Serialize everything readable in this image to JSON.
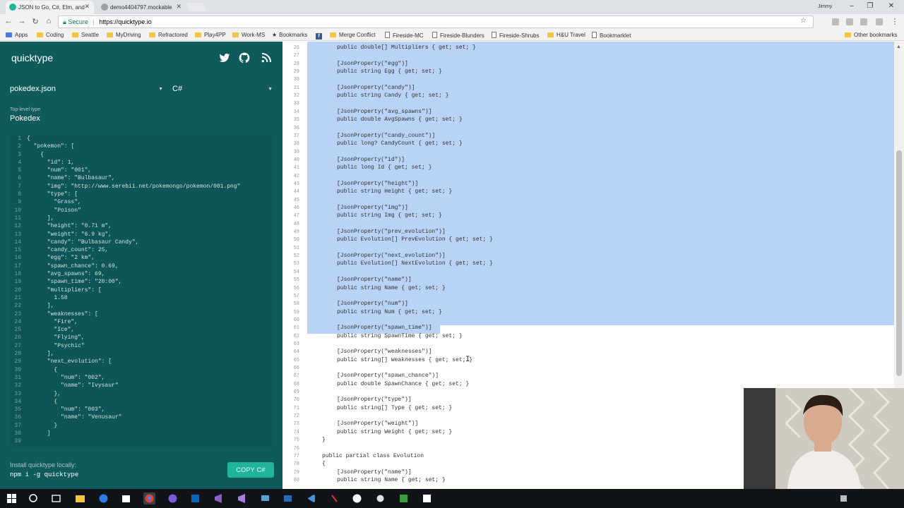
{
  "browser": {
    "tabs": [
      {
        "title": "JSON to Go, C#, Elm, and",
        "active": true,
        "favicon_color": "#1fb59c"
      },
      {
        "title": "demo4404797.mockable",
        "active": false,
        "favicon_color": "#9aa0a6"
      }
    ],
    "profile_name": "Jimmy",
    "window_controls": [
      "minimize-icon",
      "restore-icon",
      "close-icon"
    ],
    "secure_label": "Secure",
    "url": "https://quicktype.io",
    "bookmarks": [
      {
        "label": "Apps",
        "icon": "apps-icon"
      },
      {
        "label": "Coding",
        "icon": "folder-icon"
      },
      {
        "label": "Seattle",
        "icon": "folder-icon"
      },
      {
        "label": "MyDriving",
        "icon": "folder-icon"
      },
      {
        "label": "Refractored",
        "icon": "folder-icon"
      },
      {
        "label": "Play4PP",
        "icon": "folder-icon"
      },
      {
        "label": "Work-MS",
        "icon": "folder-icon"
      },
      {
        "label": "Bookmarks",
        "icon": "star-icon"
      },
      {
        "label": "",
        "icon": "facebook-icon"
      },
      {
        "label": "Merge Conflict",
        "icon": "folder-icon"
      },
      {
        "label": "Fireside-MC",
        "icon": "doc-icon"
      },
      {
        "label": "Fireside-Blunders",
        "icon": "doc-icon"
      },
      {
        "label": "Fireside-Shrubs",
        "icon": "doc-icon"
      },
      {
        "label": "H&U Travel",
        "icon": "folder-icon"
      },
      {
        "label": "Bookmarklet",
        "icon": "doc-icon"
      }
    ],
    "other_bookmarks": "Other bookmarks"
  },
  "sidebar": {
    "brand": "quicktype",
    "social_icons": [
      "twitter-icon",
      "github-icon",
      "rss-icon"
    ],
    "source_file": "pokedex.json",
    "language": "C#",
    "toplevel_label": "Top-level type",
    "toplevel_value": "Pokedex",
    "json_lines": [
      {
        "n": "1",
        "t": "{"
      },
      {
        "n": "2",
        "t": "  \"pokemon\": ["
      },
      {
        "n": "3",
        "t": "    {"
      },
      {
        "n": "4",
        "t": "      \"id\": 1,"
      },
      {
        "n": "5",
        "t": "      \"num\": \"001\","
      },
      {
        "n": "6",
        "t": "      \"name\": \"Bulbasaur\","
      },
      {
        "n": "7",
        "t": "      \"img\": \"http://www.serebii.net/pokemongo/pokemon/001.png\""
      },
      {
        "n": "8",
        "t": "      \"type\": ["
      },
      {
        "n": "9",
        "t": "        \"Grass\","
      },
      {
        "n": "10",
        "t": "        \"Poison\""
      },
      {
        "n": "11",
        "t": "      ],"
      },
      {
        "n": "12",
        "t": "      \"height\": \"0.71 m\","
      },
      {
        "n": "13",
        "t": "      \"weight\": \"6.9 kg\","
      },
      {
        "n": "14",
        "t": "      \"candy\": \"Bulbasaur Candy\","
      },
      {
        "n": "15",
        "t": "      \"candy_count\": 25,"
      },
      {
        "n": "16",
        "t": "      \"egg\": \"2 km\","
      },
      {
        "n": "17",
        "t": "      \"spawn_chance\": 0.69,"
      },
      {
        "n": "18",
        "t": "      \"avg_spawns\": 69,"
      },
      {
        "n": "19",
        "t": "      \"spawn_time\": \"20:00\","
      },
      {
        "n": "20",
        "t": "      \"multipliers\": ["
      },
      {
        "n": "21",
        "t": "        1.58"
      },
      {
        "n": "22",
        "t": "      ],"
      },
      {
        "n": "23",
        "t": "      \"weaknesses\": ["
      },
      {
        "n": "24",
        "t": "        \"Fire\","
      },
      {
        "n": "25",
        "t": "        \"Ice\","
      },
      {
        "n": "26",
        "t": "        \"Flying\","
      },
      {
        "n": "27",
        "t": "        \"Psychic\""
      },
      {
        "n": "28",
        "t": "      ],"
      },
      {
        "n": "29",
        "t": "      \"next_evolution\": ["
      },
      {
        "n": "30",
        "t": "        {"
      },
      {
        "n": "31",
        "t": "          \"num\": \"002\","
      },
      {
        "n": "32",
        "t": "          \"name\": \"Ivysaur\""
      },
      {
        "n": "33",
        "t": "        },"
      },
      {
        "n": "34",
        "t": "        {"
      },
      {
        "n": "35",
        "t": "          \"num\": \"003\","
      },
      {
        "n": "36",
        "t": "          \"name\": \"Venusaur\""
      },
      {
        "n": "37",
        "t": "        }"
      },
      {
        "n": "38",
        "t": "      ]"
      },
      {
        "n": "39",
        "t": ""
      }
    ],
    "install_label": "Install quicktype locally:",
    "install_cmd": "npm i -g quicktype",
    "copy_button": "COPY C#"
  },
  "code": {
    "lines": [
      {
        "n": "26",
        "t": "        public double[] Multipliers { get; set; }"
      },
      {
        "n": "27",
        "t": ""
      },
      {
        "n": "28",
        "t": "        [JsonProperty(\"egg\")]"
      },
      {
        "n": "29",
        "t": "        public string Egg { get; set; }"
      },
      {
        "n": "30",
        "t": ""
      },
      {
        "n": "31",
        "t": "        [JsonProperty(\"candy\")]"
      },
      {
        "n": "32",
        "t": "        public string Candy { get; set; }"
      },
      {
        "n": "33",
        "t": ""
      },
      {
        "n": "34",
        "t": "        [JsonProperty(\"avg_spawns\")]"
      },
      {
        "n": "35",
        "t": "        public double AvgSpawns { get; set; }"
      },
      {
        "n": "36",
        "t": ""
      },
      {
        "n": "37",
        "t": "        [JsonProperty(\"candy_count\")]"
      },
      {
        "n": "38",
        "t": "        public long? CandyCount { get; set; }"
      },
      {
        "n": "39",
        "t": ""
      },
      {
        "n": "40",
        "t": "        [JsonProperty(\"id\")]"
      },
      {
        "n": "41",
        "t": "        public long Id { get; set; }"
      },
      {
        "n": "42",
        "t": ""
      },
      {
        "n": "43",
        "t": "        [JsonProperty(\"height\")]"
      },
      {
        "n": "44",
        "t": "        public string Height { get; set; }"
      },
      {
        "n": "45",
        "t": ""
      },
      {
        "n": "46",
        "t": "        [JsonProperty(\"img\")]"
      },
      {
        "n": "47",
        "t": "        public string Img { get; set; }"
      },
      {
        "n": "48",
        "t": ""
      },
      {
        "n": "49",
        "t": "        [JsonProperty(\"prev_evolution\")]"
      },
      {
        "n": "50",
        "t": "        public Evolution[] PrevEvolution { get; set; }"
      },
      {
        "n": "51",
        "t": ""
      },
      {
        "n": "52",
        "t": "        [JsonProperty(\"next_evolution\")]"
      },
      {
        "n": "53",
        "t": "        public Evolution[] NextEvolution { get; set; }"
      },
      {
        "n": "54",
        "t": ""
      },
      {
        "n": "55",
        "t": "        [JsonProperty(\"name\")]"
      },
      {
        "n": "56",
        "t": "        public string Name { get; set; }"
      },
      {
        "n": "57",
        "t": ""
      },
      {
        "n": "58",
        "t": "        [JsonProperty(\"num\")]"
      },
      {
        "n": "59",
        "t": "        public string Num { get; set; }"
      },
      {
        "n": "60",
        "t": ""
      },
      {
        "n": "61",
        "t": "        [JsonProperty(\"spawn_time\")]"
      },
      {
        "n": "62",
        "t": "        public string SpawnTime { get; set; }"
      },
      {
        "n": "63",
        "t": ""
      },
      {
        "n": "64",
        "t": "        [JsonProperty(\"weaknesses\")]"
      },
      {
        "n": "65",
        "t": "        public string[] Weaknesses { get; set; }"
      },
      {
        "n": "66",
        "t": ""
      },
      {
        "n": "67",
        "t": "        [JsonProperty(\"spawn_chance\")]"
      },
      {
        "n": "68",
        "t": "        public double SpawnChance { get; set; }"
      },
      {
        "n": "69",
        "t": ""
      },
      {
        "n": "70",
        "t": "        [JsonProperty(\"type\")]"
      },
      {
        "n": "71",
        "t": "        public string[] Type { get; set; }"
      },
      {
        "n": "72",
        "t": ""
      },
      {
        "n": "73",
        "t": "        [JsonProperty(\"weight\")]"
      },
      {
        "n": "74",
        "t": "        public string Weight { get; set; }"
      },
      {
        "n": "75",
        "t": "    }"
      },
      {
        "n": "76",
        "t": ""
      },
      {
        "n": "77",
        "t": "    public partial class Evolution"
      },
      {
        "n": "78",
        "t": "    {"
      },
      {
        "n": "79",
        "t": "        [JsonProperty(\"name\")]"
      },
      {
        "n": "80",
        "t": "        public string Name { get; set; }"
      }
    ]
  },
  "taskbar": {
    "apps": [
      "windows-start-icon",
      "search-icon",
      "task-view-icon",
      "file-explorer-icon",
      "edge-icon",
      "store-icon",
      "chrome-icon",
      "github-desktop-icon",
      "outlook-icon",
      "visual-studio-icon",
      "visual-studio-preview-icon",
      "vscode-icon",
      "remote-desktop-icon",
      "powershell-icon",
      "xbox-icon",
      "fiddler-icon",
      "slack-icon",
      "camtasia-icon",
      "terminal-icon"
    ]
  },
  "colors": {
    "sidebar_bg": "#0f5b5c",
    "accent": "#1fb59c",
    "selection": "#b9d3f6"
  }
}
